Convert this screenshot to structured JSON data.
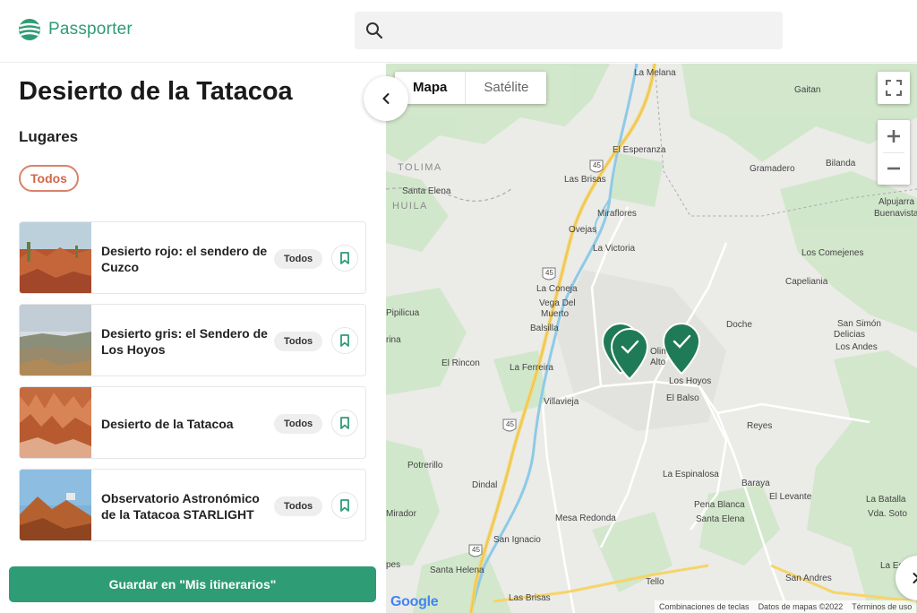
{
  "header": {
    "logo_text": "Passporter",
    "search_placeholder": ""
  },
  "panel": {
    "title": "Desierto de la Tatacoa",
    "section_label": "Lugares",
    "filter_chip": "Todos",
    "places": [
      {
        "title": "Desierto rojo: el sendero de Cuzco",
        "tag": "Todos",
        "photo": "red-desert"
      },
      {
        "title": "Desierto gris: el Sendero de Los Hoyos",
        "tag": "Todos",
        "photo": "grey-desert"
      },
      {
        "title": "Desierto de la Tatacoa",
        "tag": "Todos",
        "photo": "tatacoa"
      },
      {
        "title": "Observatorio Astronómico de la Tatacoa STARLIGHT",
        "tag": "Todos",
        "photo": "observatory"
      }
    ],
    "save_button": "Guardar en \"Mis itinerarios\""
  },
  "map": {
    "tab_map": "Mapa",
    "tab_satellite": "Satélite",
    "google": "Google",
    "footer": {
      "shortcuts": "Combinaciones de teclas",
      "data": "Datos de mapas ©2022",
      "terms": "Términos de uso"
    },
    "road_shield": "45",
    "regions": [
      "TOLIMA",
      "HUILA"
    ],
    "places": [
      "La Melana",
      "Gaitan",
      "El Esperanza",
      "Gramadero",
      "Bilanda",
      "Alpujarra",
      "Buenavista",
      "Las Brisas",
      "Santa Elena",
      "Miraflores",
      "Ovejas",
      "La Victoria",
      "Los Comejenes",
      "La Coneja",
      "Capeliania",
      "Vega Del",
      "Muerto",
      "Pipilicua",
      "Doche",
      "San Simón",
      "Delicias",
      "Balsilla",
      "Los Andes",
      "rina",
      "El Rincon",
      "La Ferreira",
      "Los Hoyos",
      "El Balso",
      "Villavieja",
      "Reyes",
      "Potrerillo",
      "La Espinalosa",
      "Dindal",
      "Baraya",
      "El Levante",
      "La Batalla",
      "Pena Blanca",
      "Vda. Soto",
      "Mirador",
      "Mesa Redonda",
      "Santa Elena",
      "San Ignacio",
      "pes",
      "Santa Helena",
      "San Andres",
      "La Esta",
      "Tello",
      "Las Brisas",
      "Olin",
      "Alto"
    ],
    "colors": {
      "marker": "#1f7a57",
      "accent": "#2e9c74",
      "road_major": "#f6d469",
      "road_minor": "#ffffff",
      "green": "#c8e6c1"
    }
  }
}
